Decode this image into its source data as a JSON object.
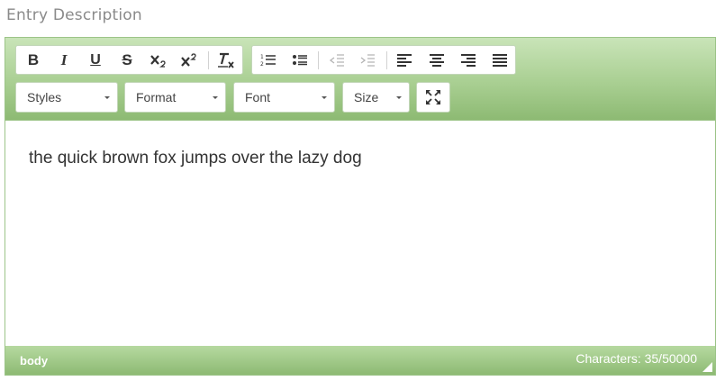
{
  "field": {
    "label": "Entry Description"
  },
  "toolbar": {
    "bold": "B",
    "italic": "I",
    "underline": "U",
    "strike": "S",
    "combos": {
      "styles": "Styles",
      "format": "Format",
      "font": "Font",
      "size": "Size"
    }
  },
  "content": {
    "text": "the quick brown fox jumps over the lazy dog"
  },
  "status": {
    "path": "body",
    "count": "Characters: 35/50000"
  },
  "colors": {
    "accent": "#8dba73",
    "toolbar_light": "#c9e4b8",
    "label": "#8a8a8a"
  },
  "icons": [
    "bold-icon",
    "italic-icon",
    "underline-icon",
    "strikethrough-icon",
    "subscript-icon",
    "superscript-icon",
    "remove-format-icon",
    "numbered-list-icon",
    "bulleted-list-icon",
    "decrease-indent-icon",
    "increase-indent-icon",
    "align-left-icon",
    "align-center-icon",
    "align-right-icon",
    "justify-icon",
    "maximize-icon"
  ]
}
